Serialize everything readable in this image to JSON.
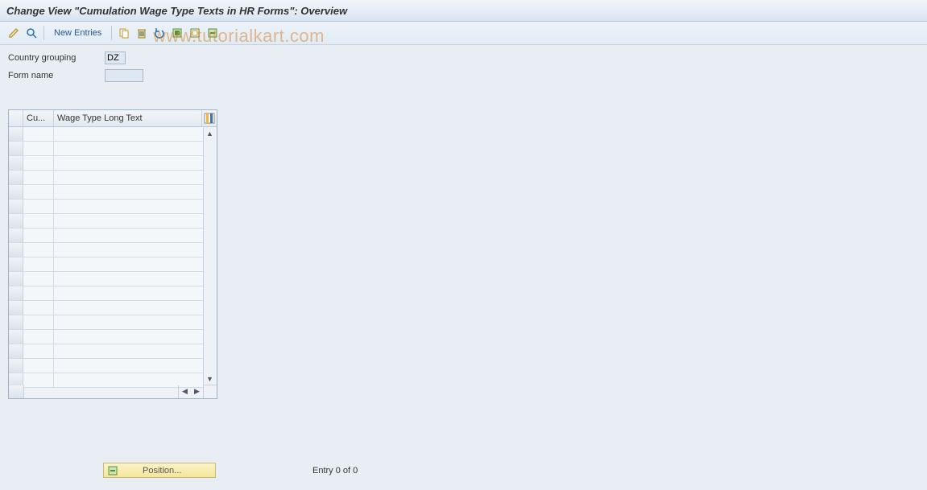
{
  "title": "Change View \"Cumulation Wage Type Texts in HR Forms\": Overview",
  "toolbar": {
    "new_entries": "New Entries"
  },
  "fields": {
    "country_label": "Country grouping",
    "country_value": "DZ",
    "form_label": "Form name",
    "form_value": ""
  },
  "table": {
    "col_cu": "Cu...",
    "col_wt": "Wage Type Long Text",
    "row_count": 18
  },
  "footer": {
    "position_label": "Position...",
    "entry_text": "Entry 0 of 0"
  },
  "watermark": "www.tutorialkart.com"
}
